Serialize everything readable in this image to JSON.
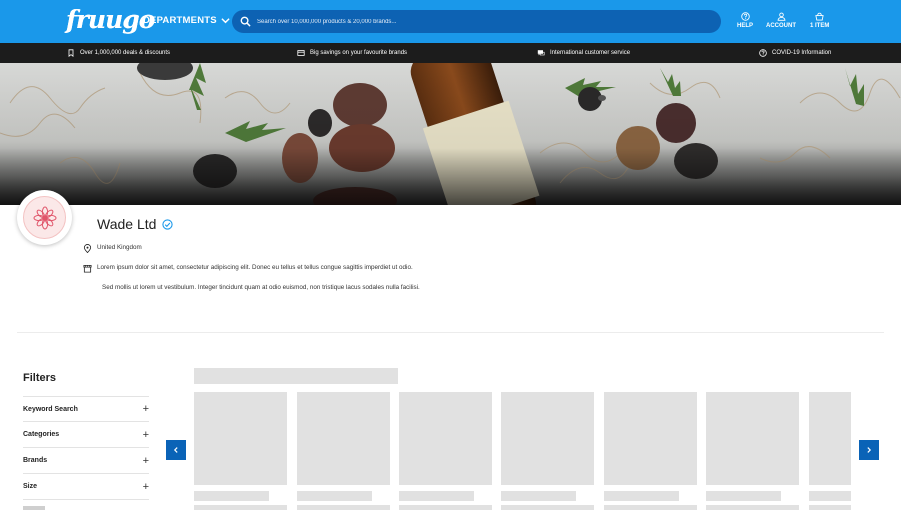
{
  "header": {
    "logo_text": "fruugo",
    "departments_label": "DEPARTMENTS",
    "search_placeholder": "Search over 10,000,000 products & 20,000 brands...",
    "help_label": "HELP",
    "account_label": "ACCOUNT",
    "basket_label": "1 ITEM"
  },
  "strip": {
    "items": [
      {
        "label": "Over 1,000,000 deals & discounts",
        "icon": "bookmark-icon"
      },
      {
        "label": "Big savings on your favourite brands",
        "icon": "card-icon"
      },
      {
        "label": "International customer service",
        "icon": "chat-icon"
      },
      {
        "label": "COVID-19 Information",
        "icon": "help-circle-icon"
      }
    ]
  },
  "store": {
    "name": "Wade Ltd",
    "location": "United Kingdom",
    "description_1": "Lorem ipsum dolor sit amet, consectetur adipiscing elit. Donec eu tellus et tellus congue sagittis imperdiet ut odio.",
    "description_2": "Sed mollis ut lorem ut vestibulum. Integer tincidunt quam at odio euismod, non tristique lacus sodales nulla facilisi."
  },
  "filters": {
    "title": "Filters",
    "items": [
      {
        "label": "Keyword Search"
      },
      {
        "label": "Categories"
      },
      {
        "label": "Brands"
      },
      {
        "label": "Size"
      }
    ]
  },
  "colors": {
    "brand_blue": "#1a98ea",
    "search_blue": "#0d62b3",
    "strip_dark": "#1c1c1c",
    "carousel_blue": "#0a63b7",
    "skeleton": "#e1e1e1",
    "store_accent": "#e0556a"
  }
}
